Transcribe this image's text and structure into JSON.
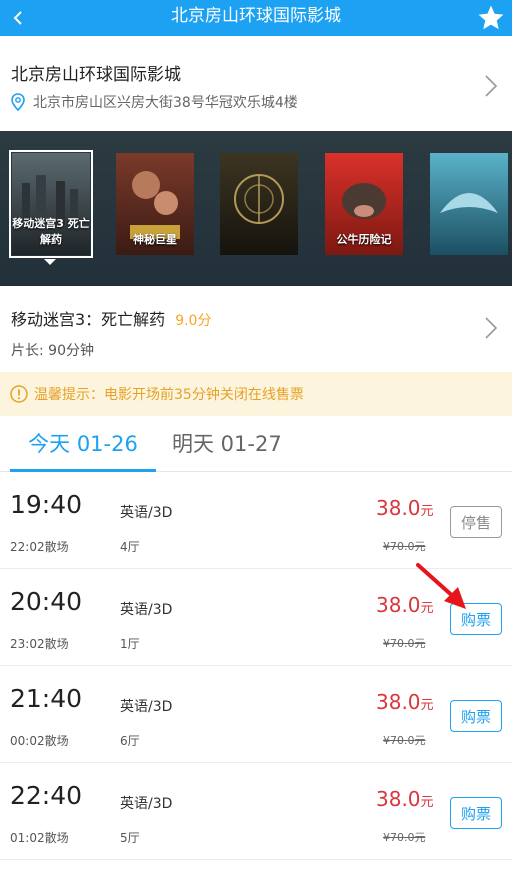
{
  "header": {
    "title": "北京房山环球国际影城",
    "back_icon": "chevron-left-icon",
    "favorite_icon": "star-icon"
  },
  "cinema": {
    "name": "北京房山环球国际影城",
    "address": "北京市房山区兴房大街38号华冠欢乐城4楼",
    "location_icon": "map-pin-icon"
  },
  "posters": [
    {
      "label": "移动迷宫3 死亡解药",
      "color_top": "#5b6a70",
      "color_bottom": "#1f2528",
      "selected": true
    },
    {
      "label": "神秘巨星",
      "color_top": "#7a3a2a",
      "color_bottom": "#3b1b14",
      "selected": false
    },
    {
      "label": "",
      "color_top": "#3d3522",
      "color_bottom": "#15130d",
      "selected": false
    },
    {
      "label": "公牛历险记",
      "color_top": "#d9322a",
      "color_bottom": "#7d1812",
      "selected": false
    },
    {
      "label": "",
      "color_top": "#5ab2c9",
      "color_bottom": "#1c4f63",
      "selected": false
    }
  ],
  "movie": {
    "title": "移动迷宫3：死亡解药",
    "score": "9.0分",
    "duration": "片长: 90分钟"
  },
  "notice": {
    "text": "温馨提示：电影开场前35分钟关闭在线售票",
    "icon": "info-icon"
  },
  "tabs": [
    {
      "label": "今天 01-26",
      "active": true
    },
    {
      "label": "明天 01-27",
      "active": false
    }
  ],
  "showtimes": [
    {
      "time": "19:40",
      "end": "22:02散场",
      "lang": "英语/3D",
      "hall": "4厅",
      "price": "38.0",
      "unit": "元",
      "orig": "¥70.0元",
      "button": "停售",
      "status": "stop"
    },
    {
      "time": "20:40",
      "end": "23:02散场",
      "lang": "英语/3D",
      "hall": "1厅",
      "price": "38.0",
      "unit": "元",
      "orig": "¥70.0元",
      "button": "购票",
      "status": "buy"
    },
    {
      "time": "21:40",
      "end": "00:02散场",
      "lang": "英语/3D",
      "hall": "6厅",
      "price": "38.0",
      "unit": "元",
      "orig": "¥70.0元",
      "button": "购票",
      "status": "buy"
    },
    {
      "time": "22:40",
      "end": "01:02散场",
      "lang": "英语/3D",
      "hall": "5厅",
      "price": "38.0",
      "unit": "元",
      "orig": "¥70.0元",
      "button": "购票",
      "status": "buy"
    }
  ],
  "colors": {
    "accent": "#1da1f2",
    "price": "#d9363e",
    "score": "#f5a623",
    "notice_bg": "#fdf4dd",
    "annotation_arrow": "#e8141c"
  }
}
